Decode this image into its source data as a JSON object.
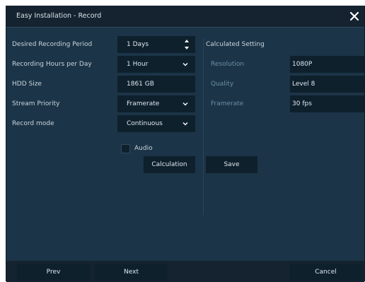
{
  "window": {
    "title": "Easy Installation - Record"
  },
  "form": {
    "recording_period": {
      "label": "Desired Recording Period",
      "value": "1 Days"
    },
    "recording_hours": {
      "label": "Recording Hours per Day",
      "value": "1 Hour"
    },
    "hdd_size": {
      "label": "HDD Size",
      "value": "1861 GB"
    },
    "stream_priority": {
      "label": "Stream Priority",
      "value": "Framerate"
    },
    "record_mode": {
      "label": "Record mode",
      "value": "Continuous"
    },
    "audio": {
      "label": "Audio",
      "checked": false
    }
  },
  "calculated": {
    "title": "Calculated Setting",
    "resolution": {
      "label": "Resolution",
      "value": "1080P"
    },
    "quality": {
      "label": "Quality",
      "value": "Level 8"
    },
    "framerate": {
      "label": "Framerate",
      "value": "30 fps"
    }
  },
  "actions": {
    "calculation": "Calculation",
    "save": "Save"
  },
  "footer": {
    "prev": "Prev",
    "next": "Next",
    "cancel": "Cancel"
  },
  "colors": {
    "window_bg": "#1b3447",
    "field_bg": "#0f202d",
    "title_bg": "#14232f",
    "dim_label": "#6d8ea8"
  }
}
